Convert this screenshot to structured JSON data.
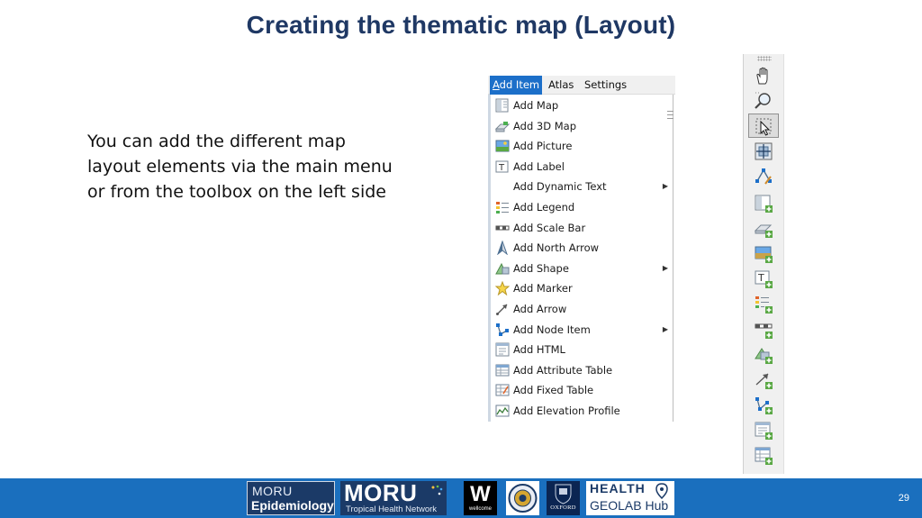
{
  "slide": {
    "title": "Creating the thematic map (Layout)",
    "body_lines": [
      "You can add the different map",
      "layout elements via the main menu",
      "or from the toolbox on the left side"
    ],
    "page_number": "29"
  },
  "menubar": {
    "items": [
      {
        "label": "Add Item",
        "underline_char": "A",
        "rest": "dd Item",
        "active": true
      },
      {
        "label": "Atlas",
        "active": false
      },
      {
        "label": "Settings",
        "active": false
      }
    ]
  },
  "add_item_menu": {
    "items": [
      {
        "label": "Add Map",
        "icon": "map-icon",
        "submenu": false
      },
      {
        "label": "Add 3D Map",
        "icon": "3d-map-icon",
        "submenu": false
      },
      {
        "label": "Add Picture",
        "icon": "picture-icon",
        "submenu": false
      },
      {
        "label": "Add Label",
        "icon": "label-icon",
        "submenu": false
      },
      {
        "label": "Add Dynamic Text",
        "icon": "",
        "submenu": true
      },
      {
        "label": "Add Legend",
        "icon": "legend-icon",
        "submenu": false
      },
      {
        "label": "Add Scale Bar",
        "icon": "scale-bar-icon",
        "submenu": false
      },
      {
        "label": "Add North Arrow",
        "icon": "north-arrow-icon",
        "submenu": false
      },
      {
        "label": "Add Shape",
        "icon": "shape-icon",
        "submenu": true
      },
      {
        "label": "Add Marker",
        "icon": "marker-icon",
        "submenu": false
      },
      {
        "label": "Add Arrow",
        "icon": "arrow-icon",
        "submenu": false
      },
      {
        "label": "Add Node Item",
        "icon": "node-item-icon",
        "submenu": true
      },
      {
        "label": "Add HTML",
        "icon": "html-icon",
        "submenu": false
      },
      {
        "label": "Add Attribute Table",
        "icon": "attribute-table-icon",
        "submenu": false
      },
      {
        "label": "Add Fixed Table",
        "icon": "fixed-table-icon",
        "submenu": false
      },
      {
        "label": "Add Elevation Profile",
        "icon": "elevation-profile-icon",
        "submenu": false
      }
    ],
    "submenu_arrow": "▶"
  },
  "toolbox": {
    "tools": [
      {
        "name": "pan-tool",
        "icon": "hand-icon",
        "selected": false
      },
      {
        "name": "zoom-tool",
        "icon": "zoom-icon",
        "selected": false
      },
      {
        "name": "select-move-tool",
        "icon": "select-icon",
        "selected": true
      },
      {
        "name": "move-content-tool",
        "icon": "move-content-icon",
        "selected": false
      },
      {
        "name": "edit-nodes-tool",
        "icon": "edit-nodes-icon",
        "selected": false
      },
      {
        "name": "add-map-tool",
        "icon": "map-icon",
        "selected": false
      },
      {
        "name": "add-3d-map-tool",
        "icon": "3d-map-icon",
        "selected": false
      },
      {
        "name": "add-picture-tool",
        "icon": "picture-icon",
        "selected": false
      },
      {
        "name": "add-label-tool",
        "icon": "label-icon",
        "selected": false
      },
      {
        "name": "add-legend-tool",
        "icon": "legend-icon",
        "selected": false
      },
      {
        "name": "add-scale-bar-tool",
        "icon": "scale-bar-icon",
        "selected": false
      },
      {
        "name": "add-shape-tool",
        "icon": "shape-icon",
        "selected": false
      },
      {
        "name": "add-arrow-tool",
        "icon": "arrow-icon",
        "selected": false
      },
      {
        "name": "add-node-item-tool",
        "icon": "node-item-icon",
        "selected": false
      },
      {
        "name": "add-html-tool",
        "icon": "html-icon",
        "selected": false
      },
      {
        "name": "add-attribute-table-tool",
        "icon": "attribute-table-icon",
        "selected": false
      }
    ]
  },
  "footer": {
    "logos": {
      "moru_epi": {
        "line1": "MORU",
        "line2": "Epidemiology"
      },
      "moru": {
        "line1": "MORU",
        "line2": "Tropical Health Network"
      },
      "wellcome": {
        "mark": "W",
        "text": "wellcome"
      },
      "oxford": {
        "text": "OXFORD"
      },
      "health_geolab": {
        "line1": "HEALTH",
        "line2": "GEOLAB Hub"
      }
    },
    "colors": {
      "bar": "#1a6fbe",
      "navy": "#1b3a67"
    }
  },
  "colors": {
    "title": "#1f3864",
    "menu_highlight": "#1c6fc9"
  }
}
